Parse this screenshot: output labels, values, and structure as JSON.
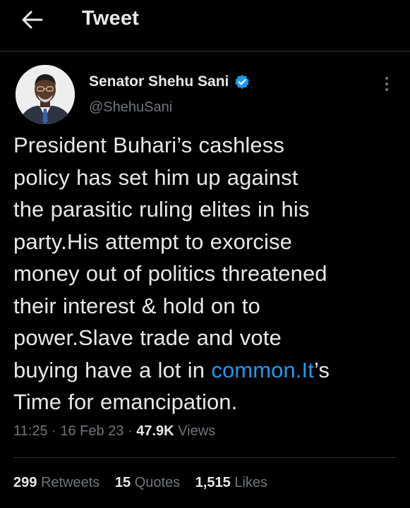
{
  "header": {
    "title": "Tweet",
    "back_icon": "arrow-left-icon"
  },
  "author": {
    "name": "Senator Shehu Sani",
    "handle": "@ShehuSani",
    "verified_icon": "verified-badge-icon",
    "verified_color": "#1d9bf0"
  },
  "tweet": {
    "lines": [
      "President Buhari’s cashless",
      "policy has set him up against",
      "the parasitic ruling elites in his",
      "party.His attempt to exorcise",
      "money out of politics threatened",
      "their interest & hold on to",
      "power.Slave trade and vote"
    ],
    "line8_prefix": "buying have a lot in ",
    "line8_link": "common.It",
    "line8_suffix": "’s",
    "line9": "Time for emancipation."
  },
  "meta": {
    "time": "11:25",
    "separator": "·",
    "date": "16 Feb 23",
    "views_count": "47.9K",
    "views_label": "Views"
  },
  "stats": {
    "retweets_count": "299",
    "retweets_label": "Retweets",
    "quotes_count": "15",
    "quotes_label": "Quotes",
    "likes_count": "1,515",
    "likes_label": "Likes"
  },
  "colors": {
    "background": "#000000",
    "text": "#e7e9ea",
    "secondary": "#71767b",
    "link": "#1d9bf0",
    "divider": "#2f3336"
  }
}
